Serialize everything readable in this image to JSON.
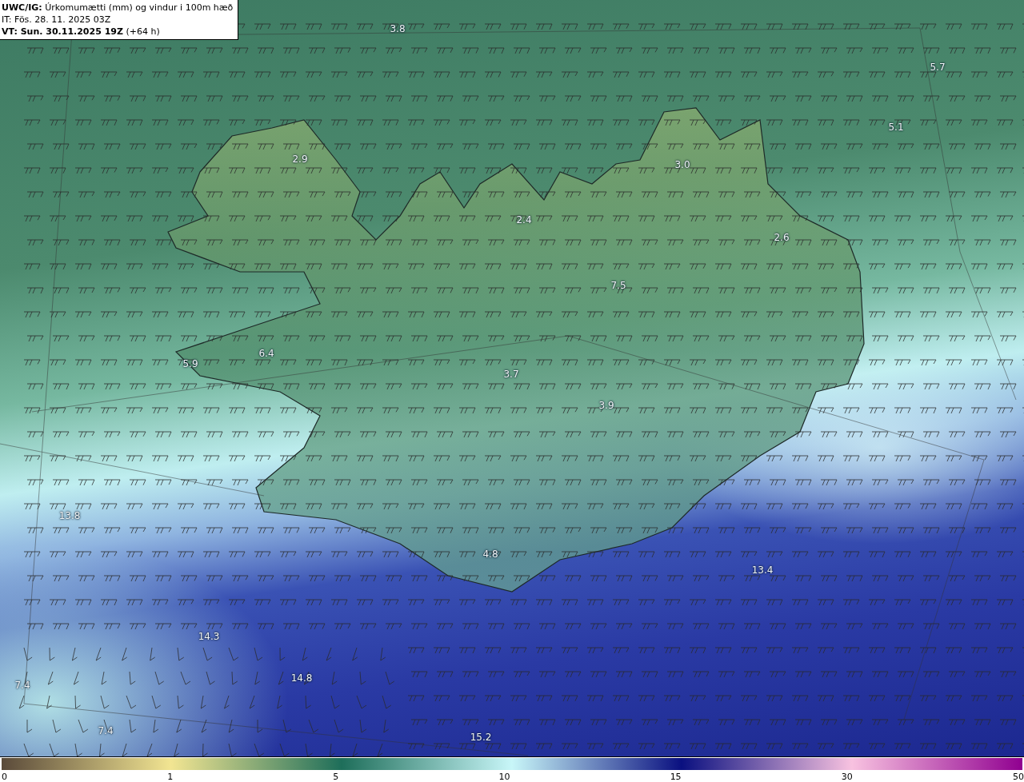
{
  "header": {
    "title": "**UWC/IG:** Úrkomumætti (mm) og vindur i 100m hæð",
    "issue_time": "IT: Fös. 28. 11. 2025 03Z",
    "valid_time": "**VT: Sun. 30.11.2025 19Z** (+64 h)"
  },
  "map_labels": [
    "3.8",
    "5.7",
    "5.1",
    "2.9",
    "3.0",
    "2.4",
    "2.6",
    "7.5",
    "6.4",
    "5.9",
    "3.7",
    "3.9",
    "13.8",
    "4.8",
    "13.4",
    "14.3",
    "14.8",
    "7.4",
    "7.4",
    "15.2"
  ],
  "colorbar": {
    "ticks": [
      "0",
      "1",
      "5",
      "10",
      "15",
      "30",
      "50"
    ]
  }
}
